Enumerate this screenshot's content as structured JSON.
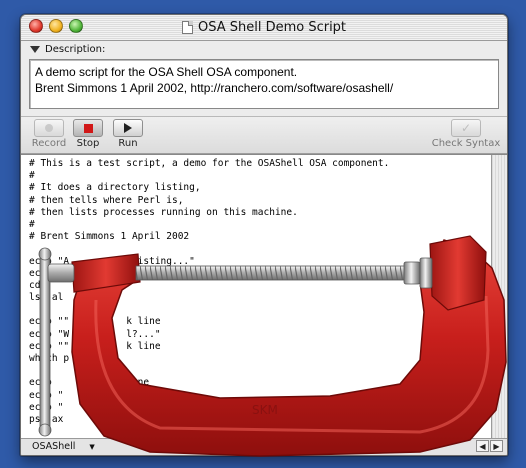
{
  "window": {
    "title": "OSA Shell Demo Script"
  },
  "description": {
    "label": "Description:",
    "lines": [
      "A demo script for the OSA Shell OSA component.",
      "Brent Simmons 1 April 2002, http://ranchero.com/software/osashell/"
    ]
  },
  "toolbar": {
    "record": "Record",
    "stop": "Stop",
    "run": "Run",
    "check_syntax": "Check Syntax"
  },
  "editor": {
    "lines": [
      "# This is a test script, a demo for the OSAShell OSA component.",
      "#",
      "# It does a directory listing,",
      "# then tells where Perl is,",
      "# then lists processes running on this machine.",
      "#",
      "# Brent Simmons 1 April 2002",
      "",
      "echo \"A           listing...\"",
      "echo",
      "cd",
      "ls -al",
      "",
      "echo \"\"          k line",
      "echo \"W          l?...\"",
      "echo \"\"          k line",
      "which p",
      "",
      "echo             line",
      "echo \"",
      "echo \"",
      "ps -ax"
    ]
  },
  "statusbar": {
    "language": "OSAShell"
  },
  "overlay": {
    "object": "c-clamp",
    "stamp": "SKM"
  },
  "colors": {
    "desktop": "#2f5aa8",
    "clamp_red": "#c81f1c",
    "stop_red": "#d11717"
  }
}
